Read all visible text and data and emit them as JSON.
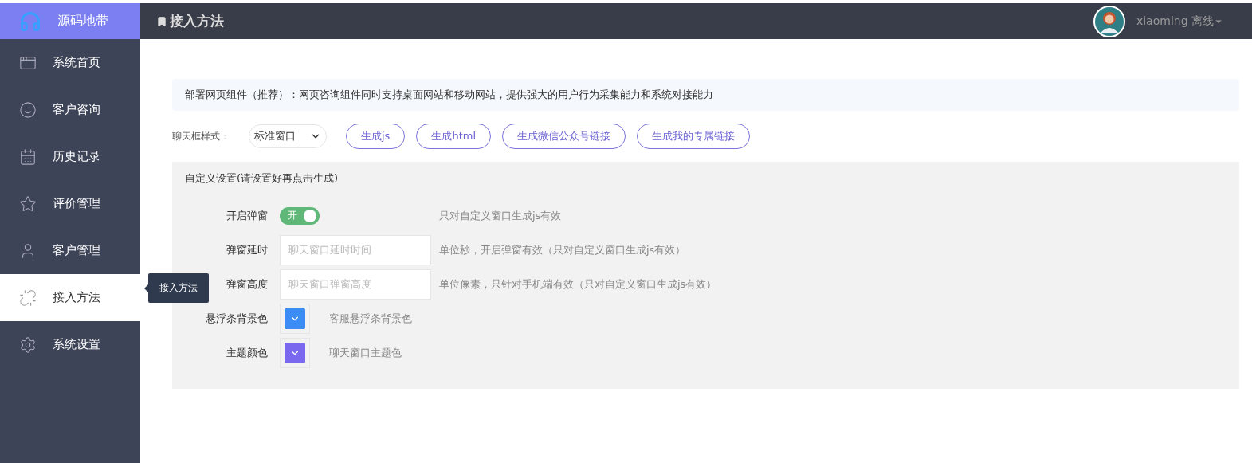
{
  "brand": {
    "name": "源码地带"
  },
  "header": {
    "title": "接入方法",
    "user": "xiaoming",
    "status": "离线"
  },
  "nav": [
    {
      "label": "系统首页",
      "selected": false
    },
    {
      "label": "客户咨询",
      "selected": false
    },
    {
      "label": "历史记录",
      "selected": false
    },
    {
      "label": "评价管理",
      "selected": false
    },
    {
      "label": "客户管理",
      "selected": false
    },
    {
      "label": "接入方法",
      "selected": true
    },
    {
      "label": "系统设置",
      "selected": false
    }
  ],
  "tooltip": "接入方法",
  "notice": "部署网页组件（推荐）：网页咨询组件同时支持桌面网站和移动网站，提供强大的用户行为采集能力和系统对接能力",
  "style_label": "聊天框样式：",
  "style_select": "标准窗口",
  "buttons": [
    "生成js",
    "生成html",
    "生成微信公众号链接",
    "生成我的专属链接"
  ],
  "settings": {
    "title": "自定义设置(请设置好再点击生成)",
    "rows": [
      {
        "kind": "toggle",
        "label": "开启弹窗",
        "on": true,
        "on_text": "开",
        "hint": "只对自定义窗口生成js有效"
      },
      {
        "kind": "input",
        "label": "弹窗延时",
        "placeholder": "聊天窗口延时时间",
        "hint": "单位秒，开启弹窗有效（只对自定义窗口生成js有效）"
      },
      {
        "kind": "input",
        "label": "弹窗高度",
        "placeholder": "聊天窗口弹窗高度",
        "hint": "单位像素，只针对手机端有效（只对自定义窗口生成js有效）"
      },
      {
        "kind": "color",
        "label": "悬浮条背景色",
        "color": "#3b8cf5",
        "hint": "客服悬浮条背景色"
      },
      {
        "kind": "color",
        "label": "主题颜色",
        "color": "#7a68ee",
        "hint": "聊天窗口主题色"
      }
    ]
  }
}
